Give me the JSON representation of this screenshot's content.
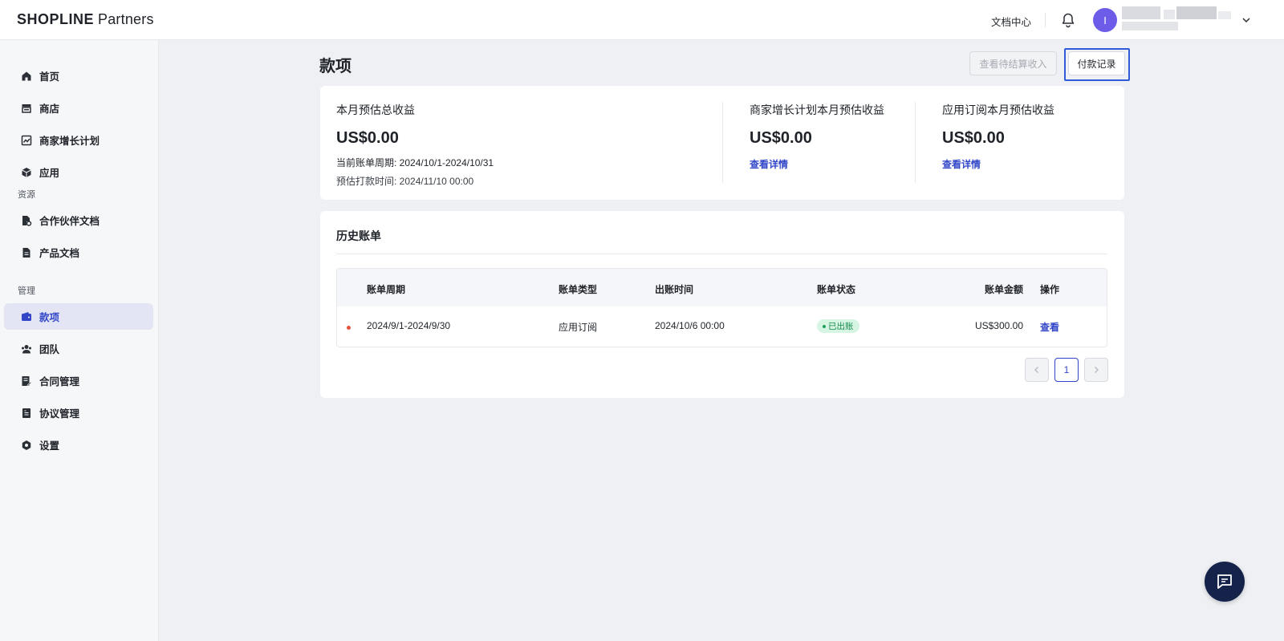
{
  "header": {
    "brand_main": "SHOPLINE",
    "brand_suffix": "Partners",
    "docs_link": "文档中心",
    "avatar_initial": "I"
  },
  "sidebar": {
    "items": [
      {
        "label": "首页",
        "icon": "home-icon"
      },
      {
        "label": "商店",
        "icon": "store-icon"
      },
      {
        "label": "商家增长计划",
        "icon": "chart-icon"
      },
      {
        "label": "应用",
        "icon": "box-icon"
      }
    ],
    "section_resources": "资源",
    "resources": [
      {
        "label": "合作伙伴文档",
        "icon": "doc-gear-icon"
      },
      {
        "label": "产品文档",
        "icon": "doc-icon"
      }
    ],
    "section_manage": "管理",
    "manage": [
      {
        "label": "款项",
        "icon": "wallet-icon",
        "active": true
      },
      {
        "label": "团队",
        "icon": "team-icon"
      },
      {
        "label": "合同管理",
        "icon": "contract-icon"
      },
      {
        "label": "协议管理",
        "icon": "agreement-icon"
      },
      {
        "label": "设置",
        "icon": "settings-icon"
      }
    ]
  },
  "page": {
    "title": "款项",
    "btn_pending": "查看待结算收入",
    "btn_payment_records": "付款记录"
  },
  "summary": {
    "total": {
      "label": "本月预估总收益",
      "amount": "US$0.00",
      "period": "当前账单周期: 2024/10/1-2024/10/31",
      "payout": "预估打款时间: 2024/11/10 00:00"
    },
    "growth": {
      "label": "商家增长计划本月预估收益",
      "amount": "US$0.00",
      "link": "查看详情"
    },
    "subscription": {
      "label": "应用订阅本月预估收益",
      "amount": "US$0.00",
      "link": "查看详情"
    }
  },
  "history": {
    "title": "历史账单",
    "columns": [
      "账单周期",
      "账单类型",
      "出账时间",
      "账单状态",
      "账单金额",
      "操作"
    ],
    "rows": [
      {
        "period": "2024/9/1-2024/9/30",
        "type": "应用订阅",
        "billed_at": "2024/10/6 00:00",
        "status": "已出账",
        "amount": "US$300.00",
        "action": "查看"
      }
    ],
    "pagination": {
      "current": "1"
    }
  },
  "colors": {
    "accent": "#3246c8",
    "focus": "#2f5bd9",
    "status_green": "#138a4a",
    "chat_fab": "#15224a"
  }
}
